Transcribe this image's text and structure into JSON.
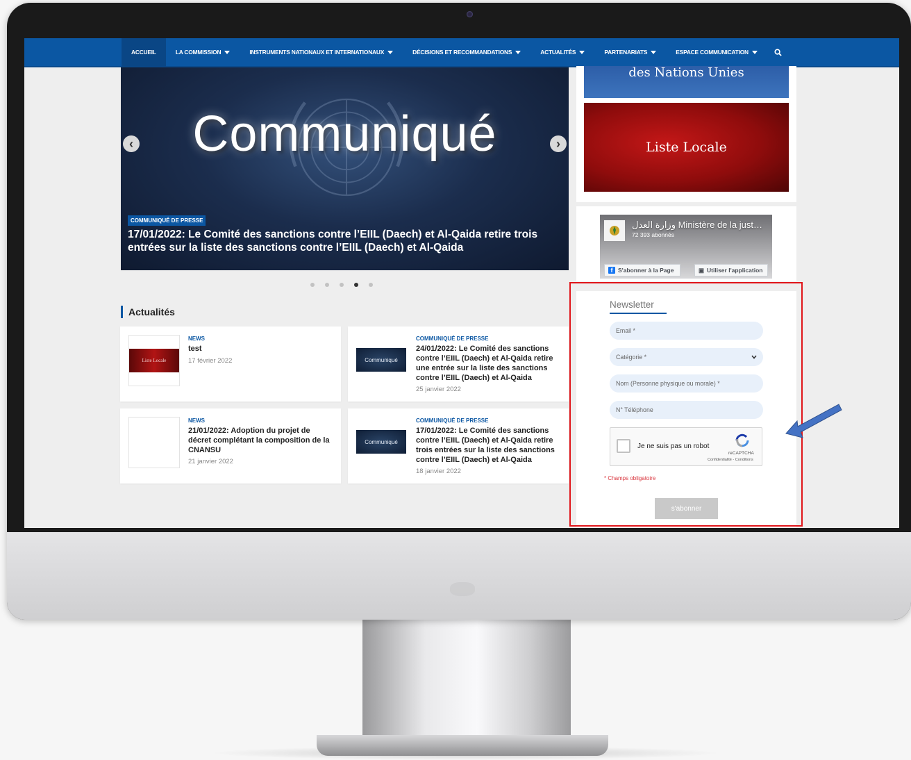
{
  "nav": {
    "items": [
      {
        "label": "ACCUEIL",
        "active": true,
        "dropdown": false
      },
      {
        "label": "LA COMMISSION",
        "active": false,
        "dropdown": true
      },
      {
        "label": "INSTRUMENTS NATIONAUX ET INTERNATIONAUX",
        "active": false,
        "dropdown": true
      },
      {
        "label": "DÉCISIONS ET RECOMMANDATIONS",
        "active": false,
        "dropdown": true
      },
      {
        "label": "ACTUALITÉS",
        "active": false,
        "dropdown": true
      },
      {
        "label": "PARTENARIATS",
        "active": false,
        "dropdown": true
      },
      {
        "label": "ESPACE COMMUNICATION",
        "active": false,
        "dropdown": true
      }
    ],
    "search_icon": "search-icon"
  },
  "slider": {
    "image_text": "Communiqué",
    "badge": "COMMUNIQUÉ DE PRESSE",
    "title": "17/01/2022: Le Comité des sanctions contre l’EIIL (Daech) et Al-Qaida retire trois entrées sur la liste des sanctions contre l’EIIL (Daech) et Al-Qaida",
    "dots": 5,
    "active_dot": 4
  },
  "news": {
    "section_title": "Actualités",
    "cards": [
      {
        "category": "NEWS",
        "title": "test",
        "date": "17 février 2022",
        "thumb_text": "Liste Locale",
        "thumb": "red"
      },
      {
        "category": "COMMUNIQUÉ DE PRESSE",
        "title": "24/01/2022: Le Comité des sanctions contre l’EIIL (Daech) et Al-Qaida retire une entrée sur la liste des sanctions contre l’EIIL (Daech) et Al-Qaida",
        "date": "25 janvier 2022",
        "thumb_text": "Communiqué",
        "thumb": "navy"
      },
      {
        "category": "NEWS",
        "title": "21/01/2022: Adoption du projet de décret complétant la composition de la CNANSU",
        "date": "21 janvier 2022",
        "thumb_text": "",
        "thumb": "blank"
      },
      {
        "category": "COMMUNIQUÉ DE PRESSE",
        "title": "17/01/2022: Le Comité des sanctions contre l’EIIL (Daech) et Al-Qaida retire trois entrées sur la liste des sanctions contre l’EIIL (Daech) et Al-Qaida",
        "date": "18 janvier 2022",
        "thumb_text": "Communiqué",
        "thumb": "navy"
      }
    ]
  },
  "sidebar": {
    "banner_un": "des Nations Unies",
    "banner_local": "Liste Locale",
    "facebook": {
      "page_name": "وزارة العدل Ministère de la just…",
      "followers": "72 393 abonnés",
      "follow_button": "S'abonner à la Page",
      "app_button": "Utiliser l'application"
    }
  },
  "newsletter": {
    "title": "Newsletter",
    "email_placeholder": "Email *",
    "category_placeholder": "Catégorie *",
    "name_placeholder": "Nom (Personne physique ou morale) *",
    "phone_placeholder": "N° Téléphone",
    "captcha_label": "Je ne suis pas un robot",
    "captcha_brand": "reCAPTCHA",
    "captcha_links": "Confidentialité - Conditions",
    "required_note": "* Champs obligatoire",
    "submit_label": "s'abonner"
  },
  "colors": {
    "brand_blue": "#0b57a3",
    "highlight_red": "#e0151a",
    "arrow_blue": "#4472c4"
  }
}
